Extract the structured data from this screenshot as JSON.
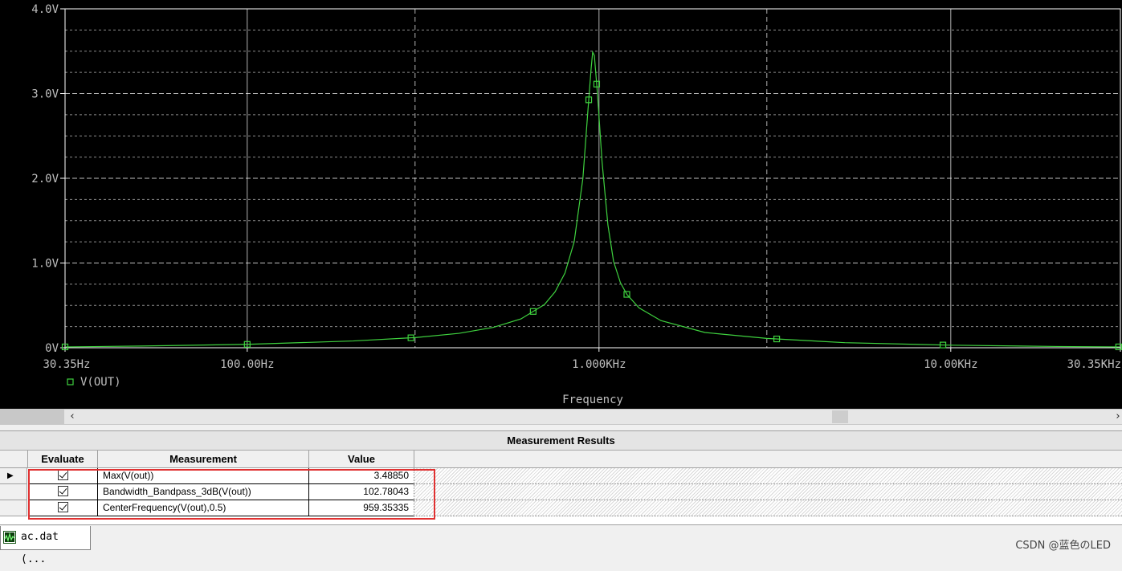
{
  "plot": {
    "background": "#000000",
    "grid_color": "#ffffff",
    "trace_color": "#3fd23f",
    "axis_text_color": "#bfbfbf",
    "x_axis_label": "Frequency",
    "x_tick_labels": [
      "30.35Hz",
      "100.00Hz",
      "1.000KHz",
      "10.00KHz",
      "30.35KHz"
    ],
    "y_tick_labels": [
      "4.0V",
      "3.0V",
      "2.0V",
      "1.0V",
      "0V"
    ],
    "legend": {
      "marker": "square-marker",
      "label": "V(OUT)"
    }
  },
  "chart_data": {
    "type": "line",
    "title": "",
    "xlabel": "Frequency",
    "ylabel": "",
    "x_scale": "log",
    "xlim": [
      30.35,
      30350
    ],
    "ylim": [
      0,
      4.0
    ],
    "grid": true,
    "legend_position": "bottom-left",
    "series": [
      {
        "name": "V(OUT)",
        "x": [
          30.35,
          50,
          100,
          200,
          300,
          400,
          500,
          600,
          700,
          750,
          800,
          850,
          900,
          930,
          950,
          959.35,
          970,
          990,
          1020,
          1060,
          1100,
          1150,
          1200,
          1300,
          1500,
          2000,
          3000,
          5000,
          10000,
          20000,
          30350
        ],
        "values": [
          0.01,
          0.02,
          0.04,
          0.08,
          0.12,
          0.17,
          0.24,
          0.34,
          0.51,
          0.66,
          0.88,
          1.25,
          2.0,
          2.8,
          3.3,
          3.4885,
          3.45,
          3.0,
          2.2,
          1.45,
          1.02,
          0.77,
          0.63,
          0.47,
          0.32,
          0.18,
          0.11,
          0.06,
          0.03,
          0.015,
          0.01
        ]
      }
    ],
    "markers_x": [
      30.35,
      100,
      292,
      650,
      935,
      985,
      1200,
      3200,
      9500,
      30000
    ]
  },
  "scrollbar": {
    "left_arrow": "‹",
    "right_arrow": "›"
  },
  "results": {
    "title": "Measurement Results",
    "headers": {
      "evaluate": "Evaluate",
      "measurement": "Measurement",
      "value": "Value"
    },
    "current_row_marker": "▶",
    "rows": [
      {
        "evaluate": true,
        "measurement": "Max(V(out))",
        "value": "3.48850"
      },
      {
        "evaluate": true,
        "measurement": "Bandwidth_Bandpass_3dB(V(out))",
        "value": "102.78043"
      },
      {
        "evaluate": true,
        "measurement": "CenterFrequency(V(out),0.5)",
        "value": "959.35335"
      }
    ],
    "highlight_color": "#e03131"
  },
  "tab": {
    "label": "ac.dat (...",
    "icon": "waveform-file-icon"
  },
  "watermark": "CSDN @蓝色のLED"
}
